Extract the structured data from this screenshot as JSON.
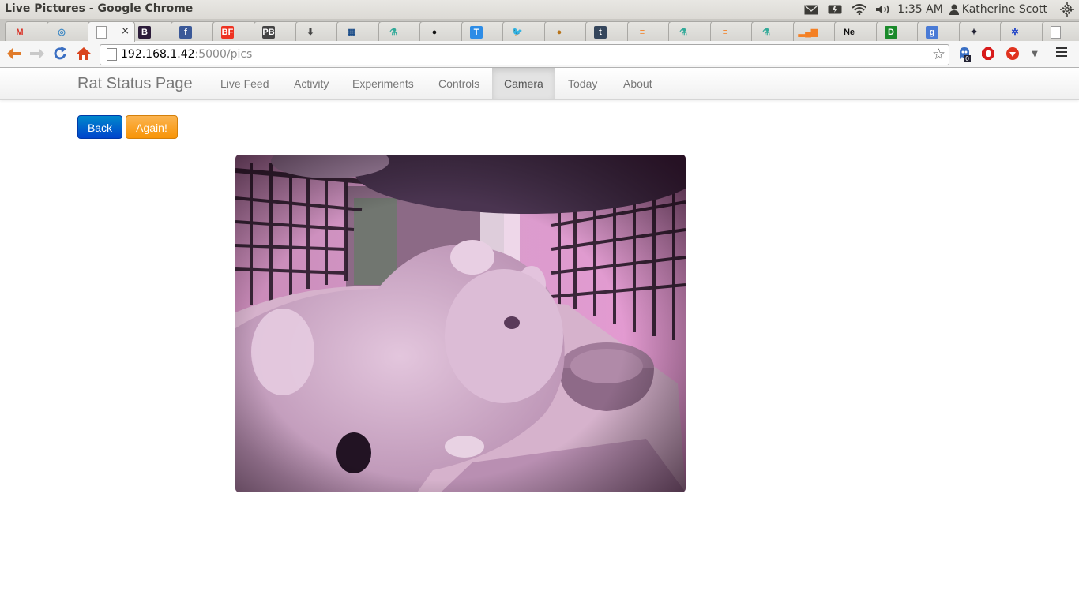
{
  "os": {
    "window_title": "Live Pictures - Google Chrome",
    "time": "1:35 AM",
    "user": "Katherine Scott",
    "icons": [
      "mail-icon",
      "battery-icon",
      "wifi-icon",
      "volume-icon",
      "user-icon",
      "settings-gear-icon"
    ]
  },
  "tabs": [
    {
      "name": "gmail",
      "glyph": "M",
      "fg": "#d93025",
      "bg": "transparent"
    },
    {
      "name": "chrome-web",
      "glyph": "◎",
      "fg": "#3b87c4",
      "bg": "transparent"
    },
    {
      "name": "live-pictures",
      "glyph": "",
      "fg": "#777",
      "bg": "transparent",
      "active": true
    },
    {
      "name": "bootstrap",
      "glyph": "B",
      "fg": "#ffffff",
      "bg": "#2c1c3a"
    },
    {
      "name": "facebook",
      "glyph": "f",
      "fg": "#ffffff",
      "bg": "#3b5998"
    },
    {
      "name": "buzzfeed",
      "glyph": "BF",
      "fg": "#ffffff",
      "bg": "#e32"
    },
    {
      "name": "pb",
      "glyph": "PB",
      "fg": "#ffffff",
      "bg": "#444"
    },
    {
      "name": "download",
      "glyph": "⬇",
      "fg": "#444",
      "bg": "transparent"
    },
    {
      "name": "grid-app",
      "glyph": "▦",
      "fg": "#1d4e89",
      "bg": "transparent"
    },
    {
      "name": "flask-1",
      "glyph": "⚗",
      "fg": "#3a9",
      "bg": "transparent"
    },
    {
      "name": "github",
      "glyph": "●",
      "fg": "#111",
      "bg": "transparent"
    },
    {
      "name": "t-app",
      "glyph": "T",
      "fg": "#ffffff",
      "bg": "#2d8ce6"
    },
    {
      "name": "twitter",
      "glyph": "🐦",
      "fg": "#1da1f2",
      "bg": "transparent"
    },
    {
      "name": "burger",
      "glyph": "●",
      "fg": "#b8741a",
      "bg": "transparent"
    },
    {
      "name": "tumblr",
      "glyph": "t",
      "fg": "#ffffff",
      "bg": "#35465c"
    },
    {
      "name": "stackoverflow-1",
      "glyph": "≡",
      "fg": "#f48024",
      "bg": "transparent"
    },
    {
      "name": "flask-2",
      "glyph": "⚗",
      "fg": "#3a9",
      "bg": "transparent"
    },
    {
      "name": "stackoverflow-2",
      "glyph": "≡",
      "fg": "#f48024",
      "bg": "transparent"
    },
    {
      "name": "flask-3",
      "glyph": "⚗",
      "fg": "#3a9",
      "bg": "transparent"
    },
    {
      "name": "signal-bars",
      "glyph": "▂▄▆",
      "fg": "#f48024",
      "bg": "transparent"
    },
    {
      "name": "ne",
      "glyph": "Ne",
      "fg": "#111",
      "bg": "transparent"
    },
    {
      "name": "d-app",
      "glyph": "D",
      "fg": "#ffffff",
      "bg": "#1a8a2a"
    },
    {
      "name": "google-plus",
      "glyph": "g",
      "fg": "#ffffff",
      "bg": "#4a7bd6"
    },
    {
      "name": "art-app",
      "glyph": "✦",
      "fg": "#223",
      "bg": "transparent"
    },
    {
      "name": "gear-app",
      "glyph": "✲",
      "fg": "#1a3fc7",
      "bg": "transparent"
    },
    {
      "name": "blank-page",
      "glyph": "",
      "fg": "#777",
      "bg": "transparent"
    }
  ],
  "toolbar": {
    "url_host": "192.168.1.42",
    "url_rest": ":5000/pics",
    "ext_badge": "0"
  },
  "navbar": {
    "brand": "Rat Status Page",
    "items": [
      {
        "label": "Live Feed",
        "name": "nav-live-feed"
      },
      {
        "label": "Activity",
        "name": "nav-activity"
      },
      {
        "label": "Experiments",
        "name": "nav-experiments"
      },
      {
        "label": "Controls",
        "name": "nav-controls"
      },
      {
        "label": "Camera",
        "name": "nav-camera",
        "active": true
      },
      {
        "label": "Today",
        "name": "nav-today"
      },
      {
        "label": "About",
        "name": "nav-about"
      }
    ]
  },
  "buttons": {
    "back": "Back",
    "again": "Again!"
  },
  "colors": {
    "btn_primary": "#0062cc",
    "btn_warning": "#f89406",
    "photo_tint": "#b47ab0"
  }
}
